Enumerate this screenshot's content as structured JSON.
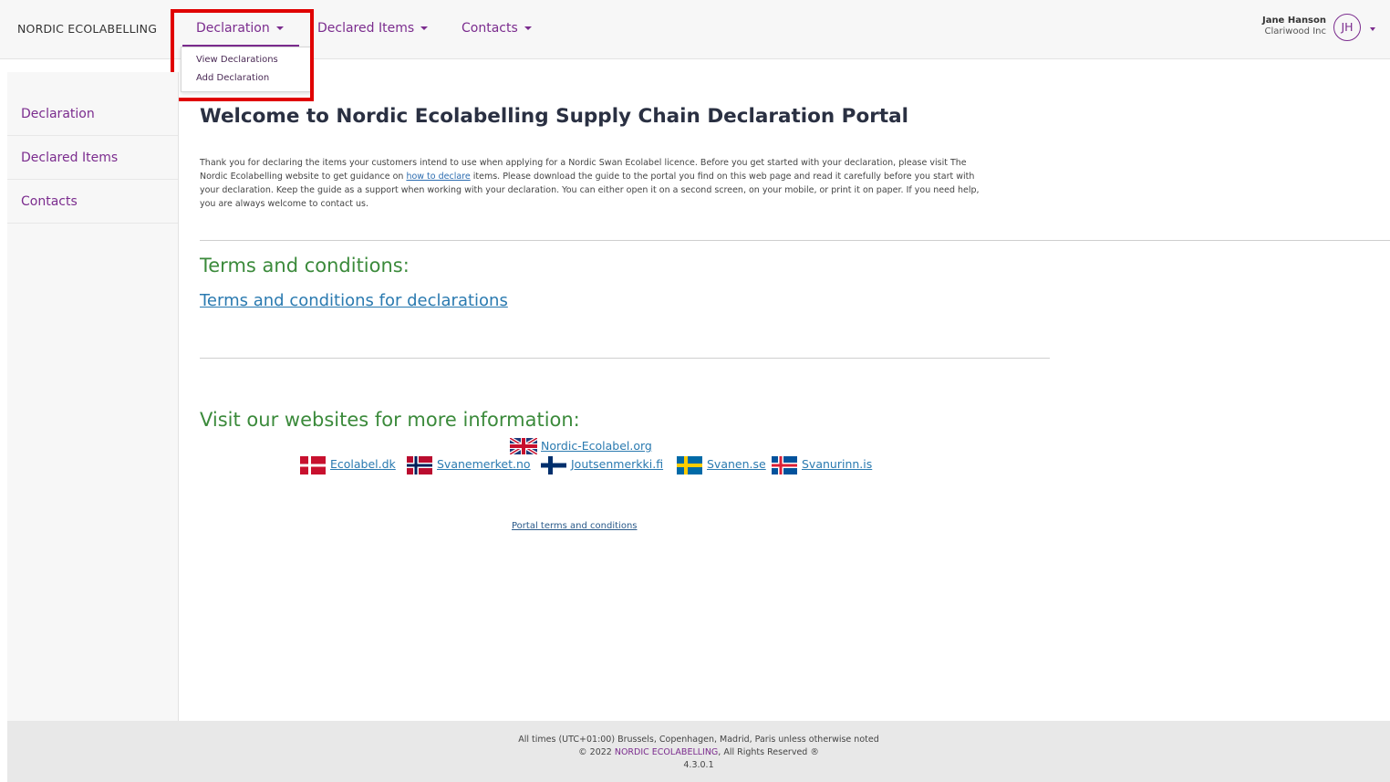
{
  "navbar": {
    "brand": "NORDIC ECOLABELLING",
    "menus": [
      "Declaration",
      "Declared Items",
      "Contacts"
    ],
    "user_name": "Jane Hanson",
    "user_org": "Clariwood Inc",
    "avatar_initials": "JH"
  },
  "dropdown": {
    "items": [
      "View Declarations",
      "Add Declaration"
    ]
  },
  "sidebar": {
    "items": [
      "Declaration",
      "Declared Items",
      "Contacts"
    ]
  },
  "main": {
    "title": "Welcome to Nordic Ecolabelling Supply Chain Declaration Portal",
    "intro_before_link": "Thank you for declaring the items your customers intend to use when applying for a Nordic Swan Ecolabel licence. Before you get started with your declaration, please visit The Nordic Ecolabelling website to get guidance on ",
    "intro_link": "how to declare",
    "intro_after_link": " items. Please download the guide to the portal you find on this web page and read it carefully before you start with your declaration. Keep the guide as a support when working with your declaration. You can either open it on a second screen, on your mobile, or print it on paper. If you need help, you are always welcome to contact us.",
    "terms_heading": "Terms and conditions:",
    "terms_link": "Terms and  conditions for declarations",
    "visit_heading": "Visit our websites for more information:",
    "sites": {
      "nordic": "Nordic-Ecolabel.org",
      "dk": "Ecolabel.dk",
      "no": "Svanemerket.no",
      "fi": "Joutsenmerkki.fi",
      "se": "Svanen.se",
      "is": "Svanurinn.is"
    },
    "portal_terms": "Portal terms and conditions"
  },
  "footer": {
    "timezone": "All times (UTC+01:00) Brussels, Copenhagen, Madrid, Paris unless otherwise noted",
    "copyright_prefix": "© 2022 ",
    "copyright_brand": "NORDIC ECOLABELLING",
    "copyright_suffix": ", All Rights Reserved ®",
    "version": "4.3.0.1"
  },
  "colors": {
    "accent": "#7b2c8e",
    "heading_green": "#3b8a3b",
    "link_blue": "#2a7ab0",
    "highlight_red": "#e00000"
  }
}
